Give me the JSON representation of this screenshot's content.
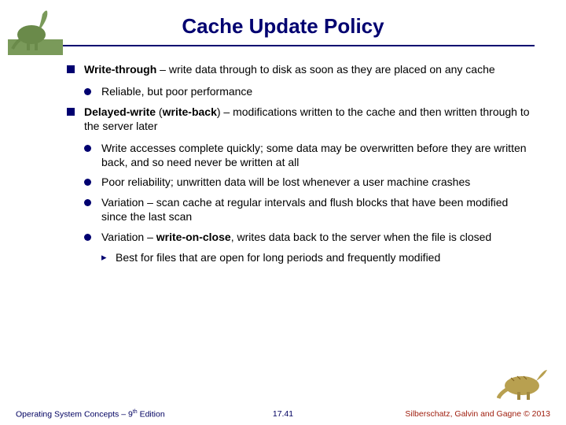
{
  "title": "Cache Update Policy",
  "bullets": {
    "p1_lead": "Write-through",
    "p1_rest": " – write data through to disk as soon as they are placed on any cache",
    "p1_sub1": "Reliable, but poor performance",
    "p2_lead": "Delayed-write",
    "p2_paren_open": " (",
    "p2_wb": "write-back",
    "p2_paren_close": ")",
    "p2_rest": " – modifications written to the cache and then written through to the server later",
    "p2_sub1": "Write accesses complete quickly; some data may be overwritten before they are written back, and so need never be written at all",
    "p2_sub2": "Poor reliability; unwritten data will be lost whenever a user machine crashes",
    "p2_sub3": "Variation – scan cache at regular intervals and flush blocks that have been modified since the last scan",
    "p2_sub4a": "Variation – ",
    "p2_sub4b": "write-on-close",
    "p2_sub4c": ", writes data back to the server when the file is closed",
    "p2_sub4_sub": "Best for files that are open for long periods and frequently modified"
  },
  "footer": {
    "left_a": "Operating System Concepts – 9",
    "left_b": " Edition",
    "center": "17.41",
    "right": "Silberschatz, Galvin and Gagne © 2013"
  }
}
